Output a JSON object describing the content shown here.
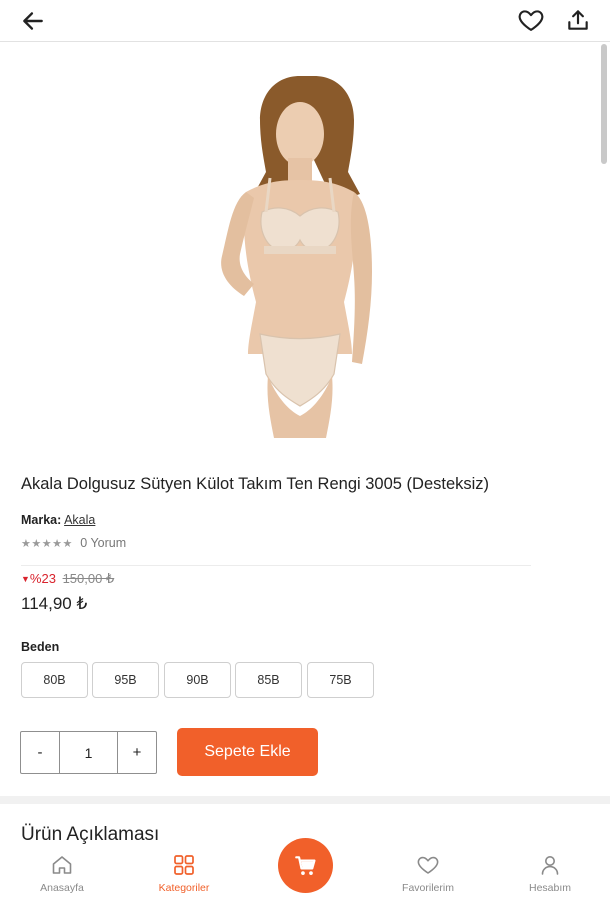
{
  "header": {
    "back_icon": "arrow-left-icon",
    "favorite_icon": "heart-outline-icon",
    "share_icon": "share-upload-icon"
  },
  "product": {
    "image_alt": "Akala Dolgusuz Sütyen Külot Takım",
    "title": "Akala Dolgusuz Sütyen Külot Takım Ten Rengi 3005 (Desteksiz)",
    "brand_label": "Marka:",
    "brand_value": "Akala",
    "stars": "★★★★★",
    "review_count": "0 Yorum",
    "discount_percent": "%23",
    "old_price": "150,00 ₺",
    "price": "114,90 ₺"
  },
  "size": {
    "label": "Beden",
    "options": [
      "80B",
      "95B",
      "90B",
      "85B",
      "75B"
    ]
  },
  "cart": {
    "decrement": "-",
    "quantity": "1",
    "increment": "+",
    "add_button": "Sepete Ekle"
  },
  "description": {
    "heading": "Ürün Açıklaması"
  },
  "bottom_nav": {
    "items": [
      {
        "label": "Anasayfa",
        "icon": "home-icon"
      },
      {
        "label": "Kategoriler",
        "icon": "grid-icon",
        "active": true
      },
      {
        "label": "Favorilerim",
        "icon": "heart-icon"
      },
      {
        "label": "Hesabım",
        "icon": "user-icon"
      }
    ],
    "cart_icon": "cart-icon"
  },
  "colors": {
    "accent": "#f1602a",
    "discount": "#d9232d",
    "text": "#222222",
    "muted": "#8a8a8a"
  }
}
